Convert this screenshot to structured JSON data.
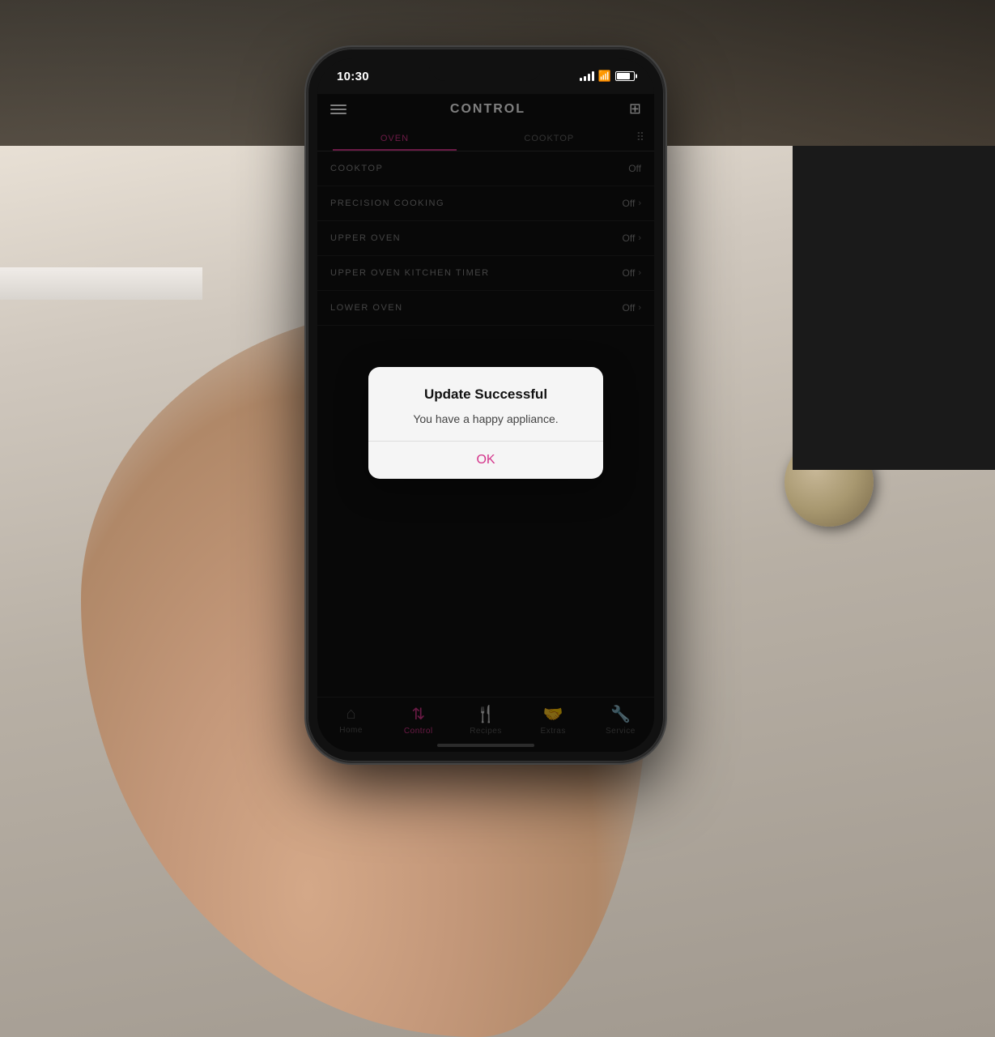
{
  "scene": {
    "background_desc": "Kitchen with white oven, hand holding phone"
  },
  "status_bar": {
    "time": "10:30",
    "location_arrow": "▲"
  },
  "header": {
    "title": "CONTROL",
    "menu_icon": "hamburger",
    "right_icon": "add-device"
  },
  "tabs": [
    {
      "id": "oven",
      "label": "OVEN",
      "active": true
    },
    {
      "id": "cooktop",
      "label": "COOKTOP",
      "active": false
    }
  ],
  "menu_items": [
    {
      "label": "COOKTOP",
      "value": "Off",
      "has_chevron": false
    },
    {
      "label": "PRECISION COOKING",
      "value": "Off",
      "has_chevron": true
    },
    {
      "label": "UPPER OVEN",
      "value": "Off",
      "has_chevron": true
    },
    {
      "label": "UPPER OVEN KITCHEN TIMER",
      "value": "Off",
      "has_chevron": true
    },
    {
      "label": "LOWER OVEN",
      "value": "Off",
      "has_chevron": true
    }
  ],
  "modal": {
    "title": "Update Successful",
    "message": "You have a happy appliance.",
    "ok_button": "OK"
  },
  "bottom_nav": [
    {
      "id": "home",
      "label": "Home",
      "icon": "🏠",
      "active": false
    },
    {
      "id": "control",
      "label": "Control",
      "icon": "⚙",
      "active": true
    },
    {
      "id": "recipes",
      "label": "Recipes",
      "icon": "🍴",
      "active": false
    },
    {
      "id": "extras",
      "label": "Extras",
      "icon": "🤝",
      "active": false
    },
    {
      "id": "service",
      "label": "Service",
      "icon": "🔧",
      "active": false
    }
  ],
  "colors": {
    "accent": "#d4348a",
    "background": "#111111",
    "text_primary": "#ffffff",
    "text_secondary": "#888888"
  }
}
